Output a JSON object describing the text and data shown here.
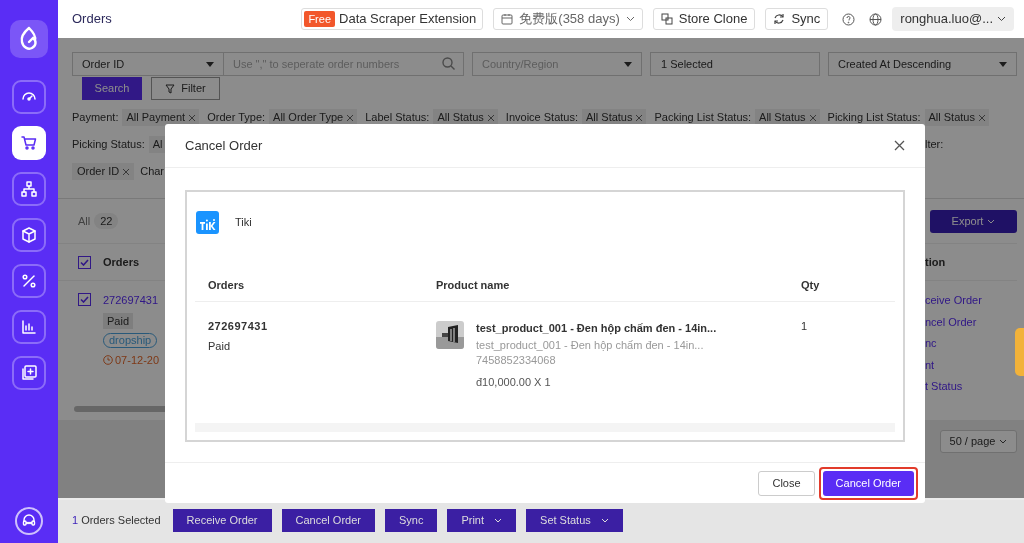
{
  "topbar": {
    "title": "Orders",
    "extension": {
      "badge": "Free",
      "label": "Data Scraper Extension"
    },
    "plan": "免费版(358 days)",
    "store_clone": "Store Clone",
    "sync": "Sync",
    "account": "ronghua.luo@..."
  },
  "sidebar": {
    "items": [
      {
        "selected": false
      },
      {
        "selected": true
      },
      {
        "selected": false
      },
      {
        "selected": false
      },
      {
        "selected": false
      },
      {
        "selected": false
      },
      {
        "selected": false
      }
    ]
  },
  "filters": {
    "field_select": "Order ID",
    "search_placeholder": "Use \",\" to seperate order numbers",
    "country_placeholder": "Country/Region",
    "selected": "1 Selected",
    "sort": "Created At Descending",
    "search_button": "Search",
    "filter_button": "Filter"
  },
  "filter_tags": [
    {
      "label": "Payment:",
      "value": "All Payment"
    },
    {
      "label": "Order Type:",
      "value": "All Order Type"
    },
    {
      "label": "Label Status:",
      "value": "All Status"
    },
    {
      "label": "Invoice Status:",
      "value": "All Status"
    },
    {
      "label": "Packing List Status:",
      "value": "All Status"
    },
    {
      "label": "Picking List Status:",
      "value": "All Status"
    }
  ],
  "picking_row": {
    "label": "Picking Status:",
    "value": "Al",
    "right_fragment": "lter:"
  },
  "chip_row": {
    "chip": "Order ID",
    "fragment": "Char"
  },
  "list": {
    "tab": "All",
    "count": "22",
    "header_checked": true,
    "header": "Orders",
    "action_header": "tion",
    "export": "Export",
    "row": {
      "checked": true,
      "order_id": "272697431",
      "status": "Paid",
      "tag": "dropship",
      "date": "07-12-20"
    },
    "actions": [
      "ceive Order",
      "ncel Order",
      "nc",
      "nt",
      "t Status"
    ],
    "page_size": "50 / page"
  },
  "modal": {
    "title": "Cancel Order",
    "store": "Tiki",
    "columns": [
      "Orders",
      "Product name",
      "Qty"
    ],
    "row": {
      "order_id": "272697431",
      "status": "Paid",
      "product_title": "test_product_001 - Đen hộp chấm đen - 14in...",
      "product_variant": "test_product_001 - Đen hộp chấm đen - 14in...",
      "sku": "7458852334068",
      "price": "đ10,000.00 X 1",
      "qty": "1"
    },
    "close": "Close",
    "confirm": "Cancel Order"
  },
  "bottom_bar": {
    "count": "1",
    "label": "Orders Selected",
    "actions": [
      {
        "label": "Receive Order",
        "dropdown": false
      },
      {
        "label": "Cancel Order",
        "dropdown": false
      },
      {
        "label": "Sync",
        "dropdown": false
      },
      {
        "label": "Print",
        "dropdown": true
      },
      {
        "label": "Set Status",
        "dropdown": true
      }
    ]
  }
}
